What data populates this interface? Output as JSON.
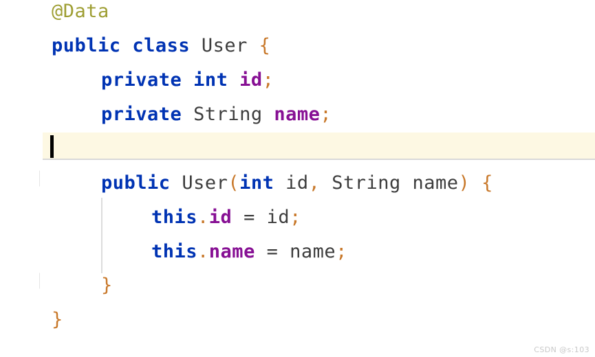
{
  "editor": {
    "language": "Java",
    "background_color": "#ffffff",
    "current_line_highlight_color": "#FDF8E3",
    "caret_color": "#000000",
    "indent_guide_color": "#dcdcdc",
    "fold_marker_color": "#e2e2e2",
    "fold_marker_glyph": "]"
  },
  "syntax_colors": {
    "annotation": "#9E9E33",
    "keyword": "#0033B3",
    "type": "#3d3d3d",
    "identifier": "#3d3d3d",
    "field": "#871094",
    "punctuation": "#C8782A",
    "operator": "#3d3d3d"
  },
  "code": {
    "full_text": "@Data\npublic class User {\n    private int id;\n    private String name;\n\n    public User(int id, String name) {\n        this.id = id;\n        this.name = name;\n    }\n}",
    "lines": [
      {
        "indent": "",
        "text": "@Data"
      },
      {
        "indent": "",
        "text": "public class User {"
      },
      {
        "indent": "    ",
        "text": "private int id;"
      },
      {
        "indent": "    ",
        "text": "private String name;"
      },
      {
        "indent": "    ",
        "text": ""
      },
      {
        "indent": "    ",
        "text": "public User(int id, String name) {"
      },
      {
        "indent": "        ",
        "text": "this.id = id;"
      },
      {
        "indent": "        ",
        "text": "this.name = name;"
      },
      {
        "indent": "    ",
        "text": "}"
      },
      {
        "indent": "",
        "text": "}"
      }
    ],
    "tokens": {
      "l1_annotation": "@Data",
      "l2_public": "public",
      "l2_class": "class",
      "l2_user": "User",
      "l2_brace": "{",
      "l3_private": "private",
      "l3_int": "int",
      "l3_id": "id",
      "l3_semi": ";",
      "l4_private": "private",
      "l4_string": "String",
      "l4_name": "name",
      "l4_semi": ";",
      "l6_public": "public",
      "l6_user": "User",
      "l6_lparen": "(",
      "l6_int": "int",
      "l6_id": "id",
      "l6_comma": ",",
      "l6_string": "String",
      "l6_name": "name",
      "l6_rparen": ")",
      "l6_brace": "{",
      "l7_this": "this",
      "l7_dot": ".",
      "l7_id": "id",
      "l7_eq": "=",
      "l7_val": "id",
      "l7_semi": ";",
      "l8_this": "this",
      "l8_dot": ".",
      "l8_name": "name",
      "l8_eq": "=",
      "l8_val": "name",
      "l8_semi": ";",
      "l9_brace": "}",
      "l10_brace": "}"
    }
  },
  "watermark": {
    "text": "CSDN @s:103"
  }
}
